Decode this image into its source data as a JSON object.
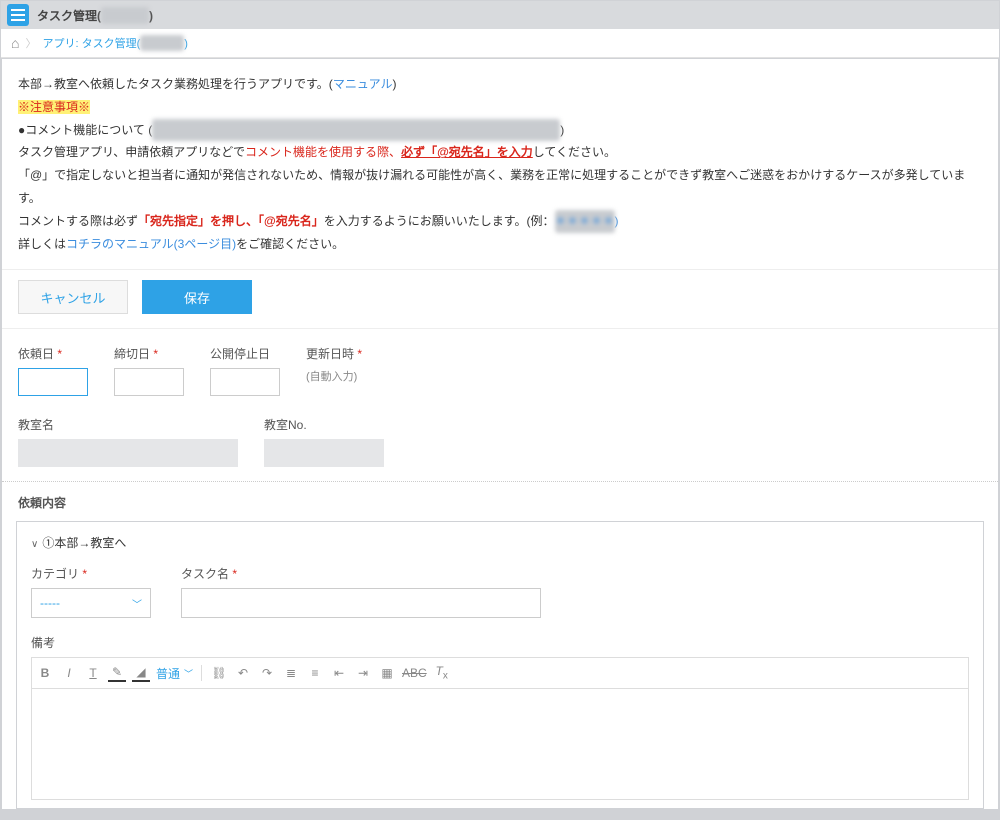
{
  "header": {
    "title_prefix": "タスク管理(",
    "title_suffix": ")",
    "title_hidden": "＊＊＊＊"
  },
  "breadcrumb": {
    "app_label_prefix": "アプリ: タスク管理(",
    "app_label_suffix": ")",
    "app_hidden": "＊＊＊＊"
  },
  "notice": {
    "line1_a": "本部→教室へ依頼したタスク業務処理を行うアプリです。(",
    "line1_link": "マニュアル",
    "line1_b": ")",
    "warn": "※注意事項※",
    "line2_a": "●コメント機能について (",
    "line2_hidden": "＊＊＊＊＊＊＊＊＊＊＊＊＊＊＊＊＊＊＊＊＊＊＊＊＊＊＊＊＊＊＊＊＊＊",
    "line2_b": ")",
    "line3_a": "タスク管理アプリ、申請依頼アプリなどで",
    "line3_b": "コメント機能を使用する際、",
    "line3_c": "必ず「@宛先名」を入力",
    "line3_d": "してください。",
    "line4": "「@」で指定しないと担当者に通知が発信されないため、情報が抜け漏れる可能性が高く、業務を正常に処理することができず教室へご迷惑をおかけするケースが多発しています。",
    "line5_a": "コメントする際は必ず",
    "line5_b": "「宛先指定」を押し、「@宛先名」",
    "line5_c": "を入力するようにお願いいたします。(例：",
    "line5_hidden": "＊＊＊＊＊",
    "line5_d": ")",
    "line6_a": "詳しくは",
    "line6_link": "コチラのマニュアル(3ページ目)",
    "line6_b": "をご確認ください。"
  },
  "actions": {
    "cancel": "キャンセル",
    "save": "保存"
  },
  "fields": {
    "request_date": "依頼日",
    "due_date": "締切日",
    "stop_date": "公開停止日",
    "updated": "更新日時",
    "updated_hint": "(自動入力)",
    "classroom_name": "教室名",
    "classroom_no": "教室No."
  },
  "section": {
    "title": "依頼内容",
    "panel_title": "①本部→教室へ",
    "category": "カテゴリ",
    "task_name": "タスク名",
    "category_value": "-----",
    "remarks": "備考",
    "size_label": "普通"
  }
}
